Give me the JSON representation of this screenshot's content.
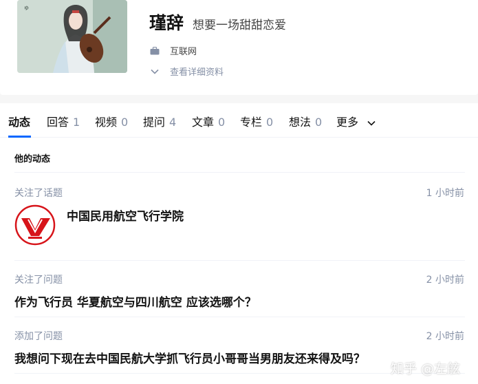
{
  "profile": {
    "name": "瑾辞",
    "headline": "想要一场甜甜恋爱",
    "industry": "互联网",
    "details_link": "查看详细资料",
    "industry_icon": "briefcase-icon",
    "details_icon": "chevron-down-icon"
  },
  "tabs": [
    {
      "label": "动态",
      "count": ""
    },
    {
      "label": "回答",
      "count": "1"
    },
    {
      "label": "视频",
      "count": "0"
    },
    {
      "label": "提问",
      "count": "4"
    },
    {
      "label": "文章",
      "count": "0"
    },
    {
      "label": "专栏",
      "count": "0"
    },
    {
      "label": "想法",
      "count": "0"
    },
    {
      "label": "更多",
      "count": ""
    }
  ],
  "activity": {
    "section_title": "他的动态",
    "items": [
      {
        "action": "关注了话题",
        "time": "1 小时前",
        "title": "中国民用航空飞行学院"
      },
      {
        "action": "关注了问题",
        "time": "2 小时前",
        "title": "作为飞行员 华夏航空与四川航空 应该选哪个？"
      },
      {
        "action": "添加了问题",
        "time": "2 小时前",
        "title": "我想问下现在去中国民航大学抓飞行员小哥哥当男朋友还来得及吗？"
      }
    ]
  },
  "colors": {
    "accent": "#0066ff",
    "logo_red": "#d7141a"
  },
  "watermark": "知乎 @左舷"
}
